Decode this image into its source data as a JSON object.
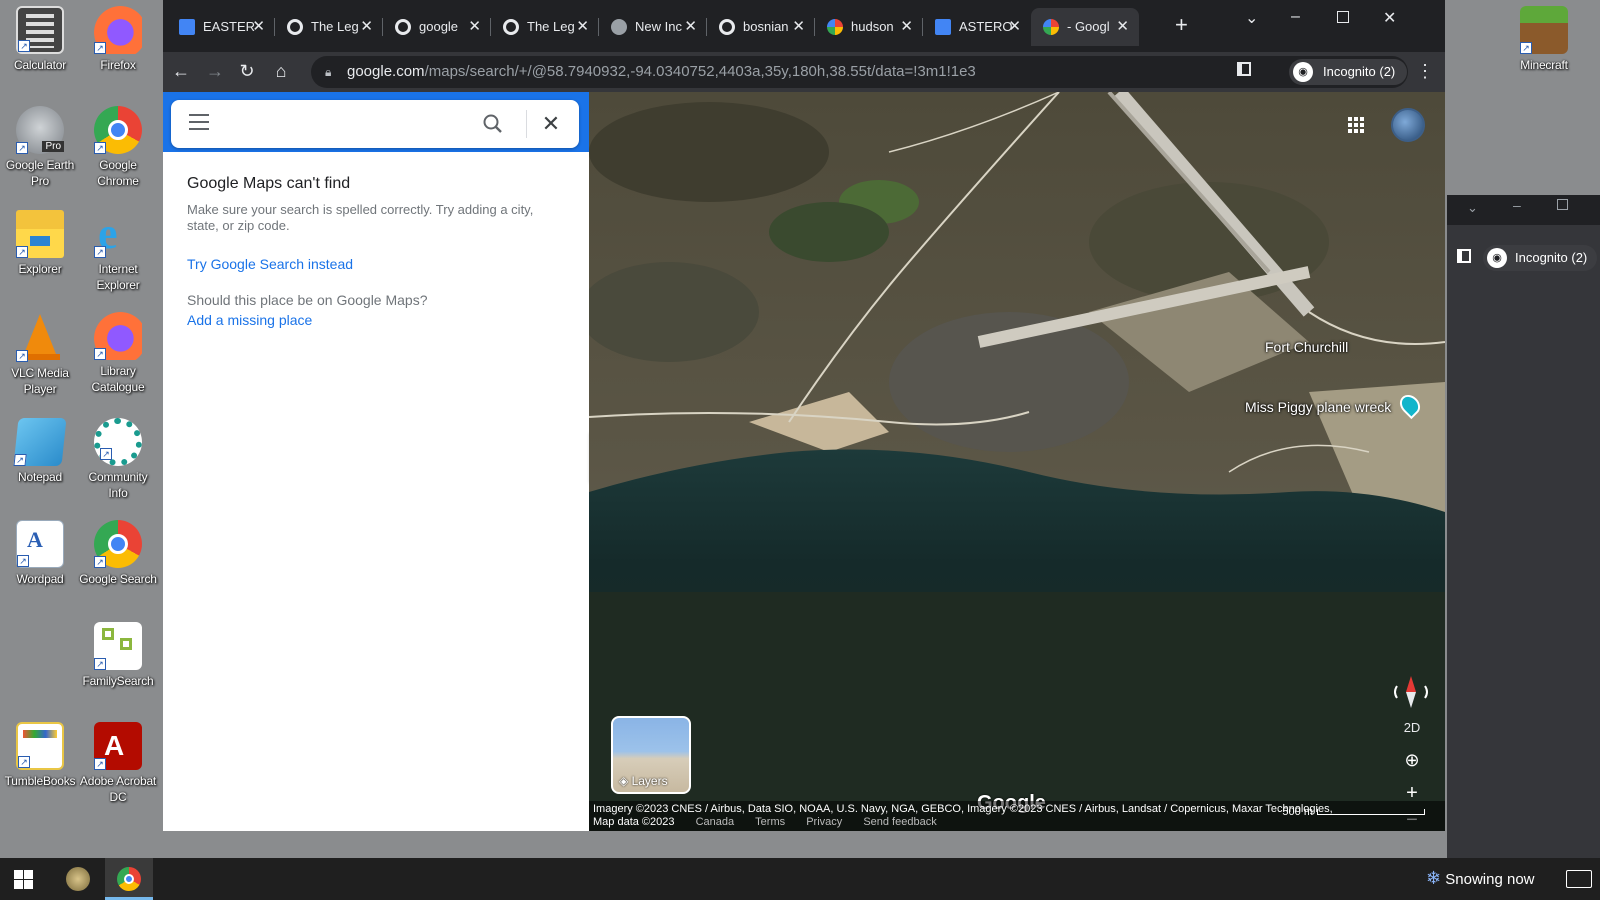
{
  "desktop": {
    "icons": [
      {
        "label": "Calculator"
      },
      {
        "label": "Firefox"
      },
      {
        "label": "Google Earth Pro"
      },
      {
        "label": "Google Chrome"
      },
      {
        "label": "Explorer"
      },
      {
        "label": "Internet Explorer"
      },
      {
        "label": "VLC Media Player"
      },
      {
        "label": "Library Catalogue"
      },
      {
        "label": "Notepad"
      },
      {
        "label": "Community Info"
      },
      {
        "label": "Wordpad"
      },
      {
        "label": "Google Search"
      },
      {
        "label": "FamilySearch"
      },
      {
        "label": "TumbleBooks"
      },
      {
        "label": "Adobe Acrobat DC"
      },
      {
        "label": "Minecraft"
      }
    ],
    "pro_badge": "Pro"
  },
  "browser": {
    "tabs": [
      {
        "label": "EASTER",
        "icon": "docs-icon"
      },
      {
        "label": "The Leg",
        "icon": "google-icon"
      },
      {
        "label": "google",
        "icon": "google-icon"
      },
      {
        "label": "The Leg",
        "icon": "google-icon"
      },
      {
        "label": "New Inc",
        "icon": "incognito-icon"
      },
      {
        "label": "bosnian",
        "icon": "google-icon"
      },
      {
        "label": "hudson",
        "icon": "maps-icon"
      },
      {
        "label": "ASTERO",
        "icon": "docs-icon"
      },
      {
        "label": "- Googl",
        "icon": "maps-icon"
      }
    ],
    "url_host": "google.com",
    "url_path": "/maps/search/+/@58.7940932,-94.0340752,4403a,35y,180h,38.55t/data=!3m1!1e3",
    "incognito_label": "Incognito (2)"
  },
  "maps": {
    "search_value": "",
    "not_found_title": "Google Maps can't find",
    "not_found_desc": "Make sure your search is spelled correctly. Try adding a city, state, or zip code.",
    "try_search_link": "Try Google Search instead",
    "question": "Should this place be on Google Maps?",
    "add_place_link": "Add a missing place",
    "labels": {
      "fort": "Fort Churchill",
      "wreck": "Miss Piggy plane wreck"
    },
    "controls": {
      "mode_2d": "2D",
      "zoom_in": "+",
      "zoom_out": "−"
    },
    "layers_label": "Layers",
    "logo": "Google",
    "attribution": "Imagery ©2023 CNES / Airbus, Data SIO, NOAA, U.S. Navy, NGA, GEBCO, Imagery ©2023 CNES / Airbus, Landsat / Copernicus, Maxar Technologies,",
    "map_data": "Map data ©2023",
    "footer_links": [
      "Canada",
      "Terms",
      "Privacy",
      "Send feedback"
    ],
    "scale": "500 m"
  },
  "right_window": {
    "incognito_label": "Incognito (2)"
  },
  "taskbar": {
    "weather": "Snowing now"
  },
  "colors": {
    "accent": "#1a73e8",
    "tab_bg": "#202124",
    "toolbar_bg": "#35363a"
  }
}
